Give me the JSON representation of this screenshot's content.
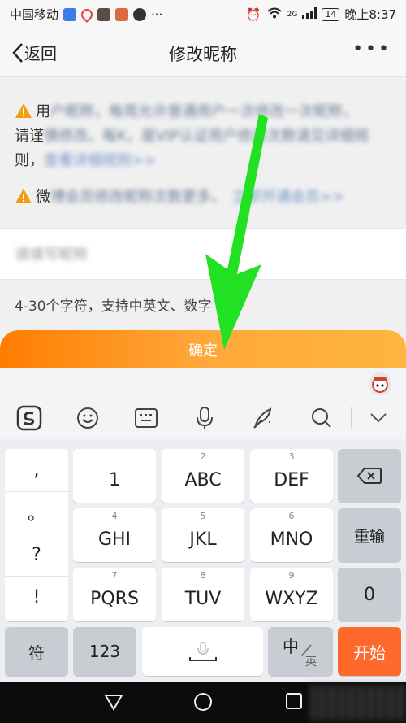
{
  "status_bar": {
    "carrier": "中国移动",
    "dots": "···",
    "signal_label": "2G",
    "battery": "14",
    "time": "晚上8:37"
  },
  "nav": {
    "back_label": "返回",
    "title": "修改昵称",
    "more": "•••"
  },
  "notice": {
    "line1_visible": "用",
    "line1_blurred": "户昵称，每周允许普通用户一次修改一次昵称，",
    "line2_visible": "请谨",
    "line2_blurred": "慎修改。每K，是VIP认证用户修改次数请见详细规",
    "line3_visible": "则，",
    "line3_blurred": "查看详细规则>>",
    "line4_visible": "微",
    "line4_blurred": "博会员修改昵称次数更多。",
    "line4_link": "立即开通会员>>"
  },
  "input": {
    "placeholder": "请填写昵称"
  },
  "hint": "4-30个字符，支持中英文、数字",
  "confirm_label": "确定",
  "keyboard": {
    "punct": [
      ",",
      "。",
      "?",
      "!"
    ],
    "rows": [
      [
        {
          "num": "",
          "main": "1"
        },
        {
          "num": "2",
          "main": "ABC"
        },
        {
          "num": "3",
          "main": "DEF"
        }
      ],
      [
        {
          "num": "4",
          "main": "GHI"
        },
        {
          "num": "5",
          "main": "JKL"
        },
        {
          "num": "6",
          "main": "MNO"
        }
      ],
      [
        {
          "num": "7",
          "main": "PQRS"
        },
        {
          "num": "8",
          "main": "TUV"
        },
        {
          "num": "9",
          "main": "WXYZ"
        }
      ]
    ],
    "relayout": "重输",
    "zero": "0",
    "symbol": "符",
    "num123": "123",
    "lang_main": "中",
    "lang_sub": "英",
    "start": "开始"
  },
  "colors": {
    "accent": "#ff8a00",
    "arrow": "#22e022",
    "start": "#ff6a2c"
  }
}
